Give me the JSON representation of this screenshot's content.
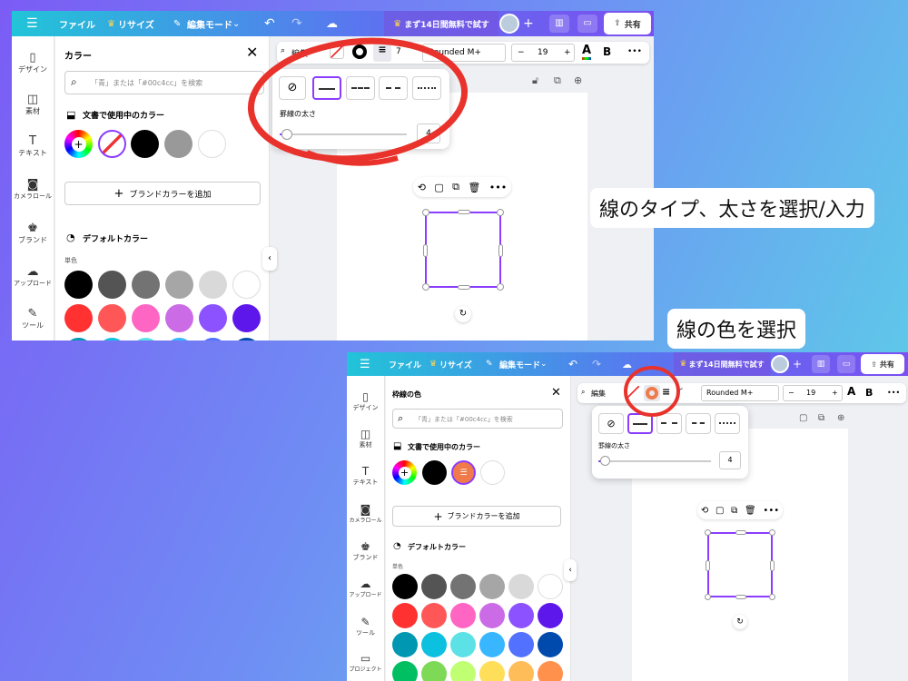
{
  "top": {
    "menu": "☰",
    "file": "ファイル",
    "resize": "リサイズ",
    "edit_mode": "編集モード",
    "trial": "まず14日間無料で試す",
    "share": "共有",
    "crown": "♛"
  },
  "sidebar": {
    "items": [
      {
        "label": "デザイン",
        "icon": "layout-icon"
      },
      {
        "label": "素材",
        "icon": "shapes-icon"
      },
      {
        "label": "テキスト",
        "icon": "text-icon"
      },
      {
        "label": "カメラロール",
        "icon": "camera-icon"
      },
      {
        "label": "ブランド",
        "icon": "brand-icon"
      },
      {
        "label": "アップロード",
        "icon": "upload-icon"
      },
      {
        "label": "ツール",
        "icon": "tool-icon"
      },
      {
        "label": "プロジェクト",
        "icon": "folder-icon"
      }
    ]
  },
  "panel1": {
    "title": "カラー",
    "search_placeholder": "「青」または「#00c4cc」を検索",
    "doc_colors": "文書で使用中のカラー",
    "add_brand": "ブランドカラーを追加",
    "default_colors": "デフォルトカラー",
    "solid": "単色"
  },
  "panel2": {
    "title": "枠線の色",
    "search_placeholder": "「青」または「#00c4cc」を検索",
    "doc_colors": "文書で使用中のカラー",
    "add_brand": "ブランドカラーを追加",
    "default_colors": "デフォルトカラー",
    "solid": "単色"
  },
  "toolbar": {
    "font": "Rounded M+",
    "size": "19",
    "minus": "−",
    "plus": "+",
    "bold": "B",
    "more": "•••",
    "edit": "編集",
    "seven": "7"
  },
  "popup": {
    "border_width_label": "罫線の太さ",
    "border_width_value": "4"
  },
  "annotations": {
    "first": "線のタイプ、太さを選択/入力",
    "second": "線の色を選択"
  },
  "colors": {
    "default_rows": [
      [
        "#000000",
        "#545454",
        "#737373",
        "#a6a6a6",
        "#d9d9d9",
        "#ffffff"
      ],
      [
        "#ff3131",
        "#ff5757",
        "#ff66c4",
        "#cb6ce6",
        "#8c52ff",
        "#5e17eb"
      ],
      [
        "#0097b2",
        "#0cc0df",
        "#5ce1e6",
        "#38b6ff",
        "#5271ff",
        "#004aad"
      ],
      [
        "#00bf63",
        "#7ed957",
        "#c1ff72",
        "#ffde59",
        "#ffbd59",
        "#ff914d"
      ]
    ],
    "accent": "#8b3dff",
    "annotation_red": "#e8322b"
  }
}
